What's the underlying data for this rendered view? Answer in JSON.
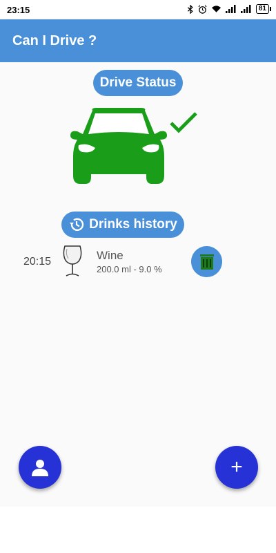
{
  "status_bar": {
    "time": "23:15",
    "battery": "81"
  },
  "app_bar": {
    "title": "Can I Drive ?"
  },
  "drive_status": {
    "label": "Drive Status",
    "status_icon": "car-icon",
    "status_color": "#1a9e1a"
  },
  "history": {
    "label": "Drinks history",
    "items": [
      {
        "time": "20:15",
        "name": "Wine",
        "detail": "200.0 ml - 9.0 %",
        "icon": "wine-glass-icon"
      }
    ]
  },
  "fab": {
    "add_label": "+"
  },
  "colors": {
    "primary": "#4a90d9",
    "fab": "#2632d6",
    "ok": "#1a9e1a"
  }
}
